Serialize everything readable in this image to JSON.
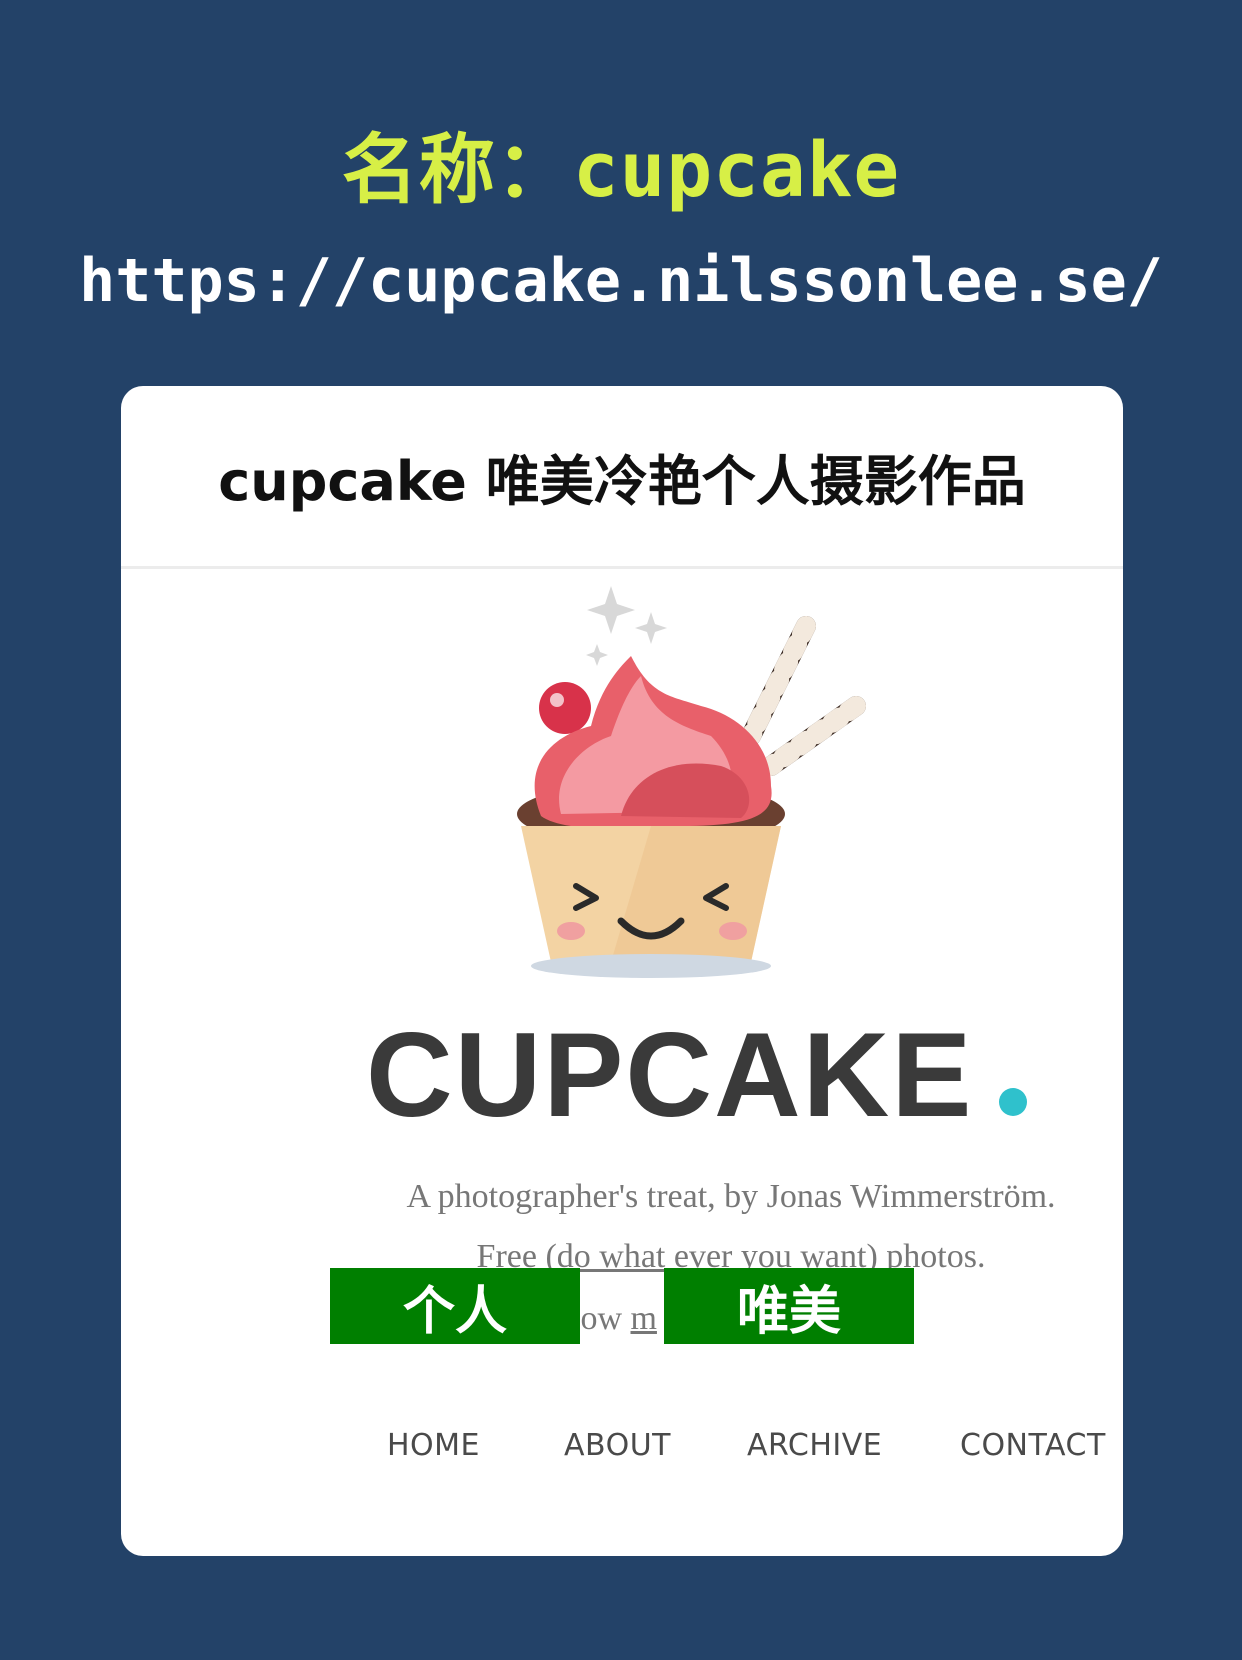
{
  "poster": {
    "title": "名称：cupcake",
    "url": "https://cupcake.nilssonlee.se/"
  },
  "card": {
    "title": "cupcake 唯美冷艳个人摄影作品",
    "wordmark": "CUPCAKE",
    "tagline": "A photographer's treat, by Jonas Wimmerström.",
    "free_line_underlined": "Free (do what ever you want)",
    "free_line_rest": " photos.",
    "follow_visible_a": "low ",
    "follow_visible_b": "m",
    "tags": [
      "个人",
      "唯美"
    ],
    "nav": [
      "HOME",
      "ABOUT",
      "ARCHIVE",
      "CONTACT"
    ]
  },
  "colors": {
    "background": "#234268",
    "title": "#d7ef46",
    "tag": "#007f00",
    "dot": "#2fc1cc"
  }
}
